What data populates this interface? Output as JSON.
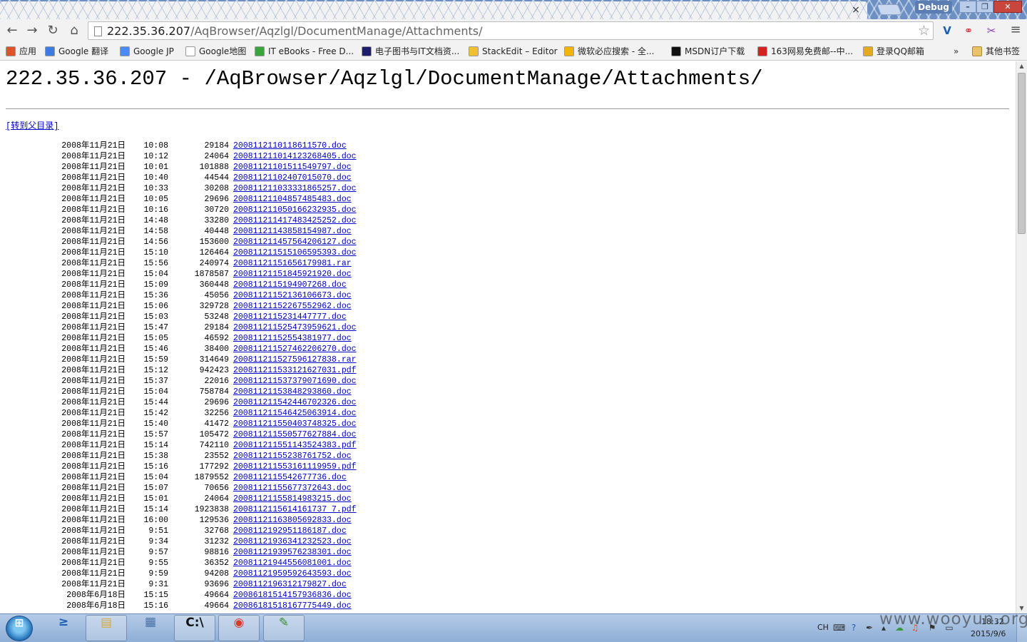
{
  "window": {
    "tab_close": "×",
    "debug_label": "Debug",
    "buttons": {
      "minimize": "–",
      "restore": "❐",
      "close": "✕"
    }
  },
  "toolbar": {
    "url_host": "222.35.36.207",
    "url_path": "/AqBrowser/Aqzlgl/DocumentManage/Attachments/",
    "icons": [
      "back-icon",
      "forward-icon",
      "reload-icon",
      "home-icon",
      "star-icon",
      "menu-icon"
    ]
  },
  "bookmarks": {
    "items": [
      {
        "label": "应用",
        "color": "#d9532c"
      },
      {
        "label": "Google 翻译",
        "color": "#3d7be0"
      },
      {
        "label": "Google JP",
        "color": "#4a8af4"
      },
      {
        "label": "Google地图",
        "color": "#ffffff"
      },
      {
        "label": "IT eBooks - Free D...",
        "color": "#3aa53a"
      },
      {
        "label": "电子图书与IT文档资...",
        "color": "#1d1d6b"
      },
      {
        "label": "StackEdit – Editor",
        "color": "#f0c030"
      },
      {
        "label": "微软必应搜索 - 全...",
        "color": "#f2b705"
      },
      {
        "label": "MSDN订户下载",
        "color": "#111111"
      },
      {
        "label": "163网易免费邮--中...",
        "color": "#d32222"
      },
      {
        "label": "登录QQ邮箱",
        "color": "#e7a81a"
      }
    ],
    "more": "»",
    "other": "其他书签"
  },
  "page": {
    "heading": "222.35.36.207 - /AqBrowser/Aqzlgl/DocumentManage/Attachments/",
    "parent_link": "[转到父目录]",
    "files": [
      {
        "date": "2008年11月21日",
        "time": "10:08",
        "size": "29184",
        "name": "20081121101186115​70.doc"
      },
      {
        "date": "2008年11月21日",
        "time": "10:12",
        "size": "24064",
        "name": "200811211014123268405.doc"
      },
      {
        "date": "2008年11月21日",
        "time": "10:01",
        "size": "101888",
        "name": "20081121101511549797.doc"
      },
      {
        "date": "2008年11月21日",
        "time": "10:40",
        "size": "44544",
        "name": "20081121102407015070.doc"
      },
      {
        "date": "2008年11月21日",
        "time": "10:33",
        "size": "30208",
        "name": "200811211033331865257.doc"
      },
      {
        "date": "2008年11月21日",
        "time": "10:05",
        "size": "29696",
        "name": "20081121104857485483.doc"
      },
      {
        "date": "2008年11月21日",
        "time": "10:16",
        "size": "30720",
        "name": "200811211050166232935.doc"
      },
      {
        "date": "2008年11月21日",
        "time": "14:48",
        "size": "33280",
        "name": "200811211417483425252.doc"
      },
      {
        "date": "2008年11月21日",
        "time": "14:58",
        "size": "40448",
        "name": "20081121143858154987.doc"
      },
      {
        "date": "2008年11月21日",
        "time": "14:56",
        "size": "153600",
        "name": "200811211457564206127.doc"
      },
      {
        "date": "2008年11月21日",
        "time": "15:10",
        "size": "126464",
        "name": "200811211515106595393.doc"
      },
      {
        "date": "2008年11月21日",
        "time": "15:56",
        "size": "240974",
        "name": "20081121151656179981.rar"
      },
      {
        "date": "2008年11月21日",
        "time": "15:04",
        "size": "1878587",
        "name": "20081121151845921920.doc"
      },
      {
        "date": "2008年11月21日",
        "time": "15:09",
        "size": "360448",
        "name": "2008112115194907268.doc"
      },
      {
        "date": "2008年11月21日",
        "time": "15:36",
        "size": "45056",
        "name": "20081121152136106673.doc"
      },
      {
        "date": "2008年11月21日",
        "time": "15:06",
        "size": "329728",
        "name": "20081121152267552962.doc"
      },
      {
        "date": "2008年11月21日",
        "time": "15:03",
        "size": "53248",
        "name": "2008112115231447777.doc"
      },
      {
        "date": "2008年11月21日",
        "time": "15:47",
        "size": "29184",
        "name": "200811211525473959621.doc"
      },
      {
        "date": "2008年11月21日",
        "time": "15:05",
        "size": "46592",
        "name": "20081121152554381977.doc"
      },
      {
        "date": "2008年11月21日",
        "time": "15:46",
        "size": "38400",
        "name": "200811211527462206270.doc"
      },
      {
        "date": "2008年11月21日",
        "time": "15:59",
        "size": "314649",
        "name": "200811211527596127838.rar"
      },
      {
        "date": "2008年11月21日",
        "time": "15:12",
        "size": "942423",
        "name": "200811211533121627031.pdf"
      },
      {
        "date": "2008年11月21日",
        "time": "15:37",
        "size": "22016",
        "name": "200811211537379071690.doc"
      },
      {
        "date": "2008年11月21日",
        "time": "15:04",
        "size": "758784",
        "name": "20081121153848293860.doc"
      },
      {
        "date": "2008年11月21日",
        "time": "15:44",
        "size": "29696",
        "name": "200811211542446702326.doc"
      },
      {
        "date": "2008年11月21日",
        "time": "15:42",
        "size": "32256",
        "name": "200811211546425063914.doc"
      },
      {
        "date": "2008年11月21日",
        "time": "15:40",
        "size": "41472",
        "name": "200811211550403748325.doc"
      },
      {
        "date": "2008年11月21日",
        "time": "15:57",
        "size": "105472",
        "name": "200811211550577627884.doc"
      },
      {
        "date": "2008年11月21日",
        "time": "15:14",
        "size": "742110",
        "name": "200811211551143524383.pdf"
      },
      {
        "date": "2008年11月21日",
        "time": "15:38",
        "size": "23552",
        "name": "20081121155238761752.doc"
      },
      {
        "date": "2008年11月21日",
        "time": "15:16",
        "size": "177292",
        "name": "200811211553161119959.pdf"
      },
      {
        "date": "2008年11月21日",
        "time": "15:04",
        "size": "1879552",
        "name": "2008112115542677736.doc"
      },
      {
        "date": "2008年11月21日",
        "time": "15:07",
        "size": "70656",
        "name": "20081121155677372643.doc"
      },
      {
        "date": "2008年11月21日",
        "time": "15:01",
        "size": "24064",
        "name": "20081121155814983215.doc"
      },
      {
        "date": "2008年11月21日",
        "time": "15:14",
        "size": "1923838",
        "name": "2008112115614161737 7.pdf"
      },
      {
        "date": "2008年11月21日",
        "time": "16:00",
        "size": "129536",
        "name": "20081121163805692833.doc"
      },
      {
        "date": "2008年11月21日",
        "time": "9:51",
        "size": "32768",
        "name": "2008112192951186187.doc"
      },
      {
        "date": "2008年11月21日",
        "time": "9:34",
        "size": "31232",
        "name": "20081121936341232523.doc"
      },
      {
        "date": "2008年11月21日",
        "time": "9:57",
        "size": "98816",
        "name": "20081121939576238301.doc"
      },
      {
        "date": "2008年11月21日",
        "time": "9:55",
        "size": "36352",
        "name": "20081121944556081001.doc"
      },
      {
        "date": "2008年11月21日",
        "time": "9:59",
        "size": "94208",
        "name": "20081121959592643593.doc"
      },
      {
        "date": "2008年11月21日",
        "time": "9:31",
        "size": "93696",
        "name": "2008112196312179827.doc"
      },
      {
        "date": "2008年6月18日",
        "time": "15:15",
        "size": "49664",
        "name": "20086181514157936836.doc"
      },
      {
        "date": "2008年6月18日",
        "time": "15:16",
        "size": "49664",
        "name": "20086181518167775449.doc"
      }
    ]
  },
  "taskbar": {
    "start_label": "⊞",
    "apps": [
      {
        "name": "powershell-app",
        "glyph": "≥",
        "color": "#1f5fb5",
        "pinned": false
      },
      {
        "name": "explorer-app",
        "glyph": "▤",
        "color": "#d9a83a",
        "pinned": true
      },
      {
        "name": "calculator-app",
        "glyph": "▦",
        "color": "#4b6fa8",
        "pinned": false
      },
      {
        "name": "cmd-app",
        "glyph": "C:\\",
        "color": "#111111",
        "pinned": true
      },
      {
        "name": "chrome-app",
        "glyph": "◉",
        "color": "#d93a2b",
        "pinned": true
      },
      {
        "name": "notepad-app",
        "glyph": "✎",
        "color": "#3a8a2a",
        "pinned": true
      }
    ],
    "tray": {
      "lang": "CH",
      "icons": [
        "keyboard-icon",
        "help-icon",
        "pen-icon",
        "arrow-up-icon",
        "network-cloud-icon",
        "sound-icon",
        "flag-icon",
        "monitor-icon"
      ],
      "time": "18:32",
      "date": "2015/9/6"
    }
  },
  "watermark": "www.wooyun.org"
}
